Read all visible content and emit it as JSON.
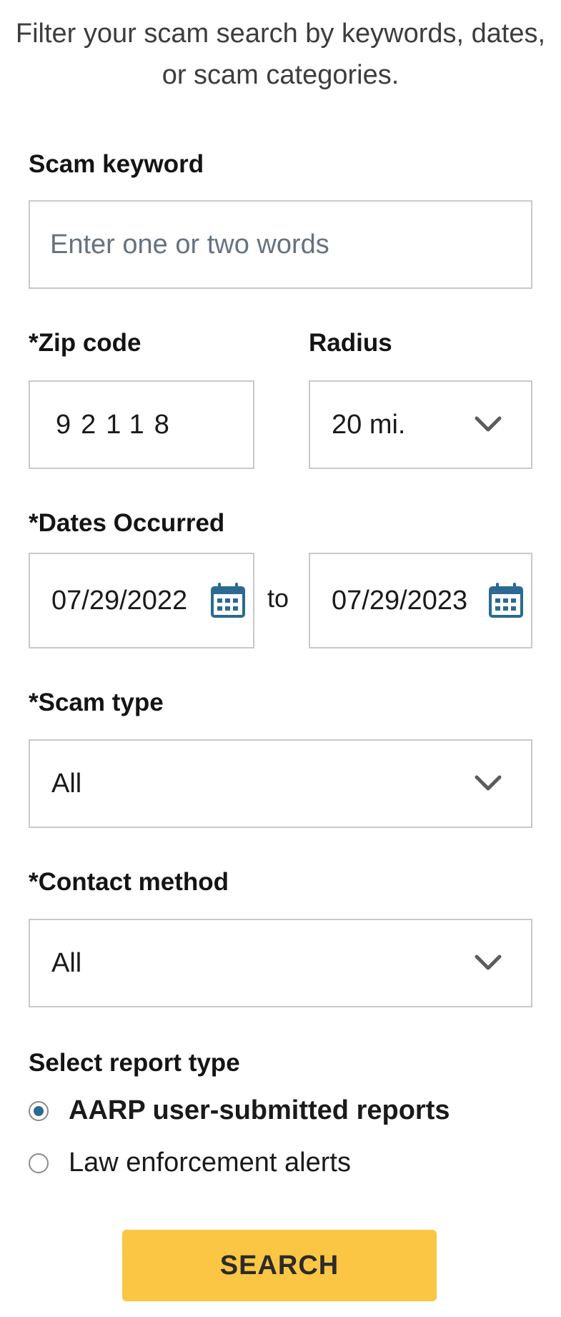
{
  "intro": {
    "line1": "Filter your scam search by keywords, dates,",
    "line2": "or scam categories."
  },
  "keyword": {
    "label": "Scam keyword",
    "placeholder": "Enter one or two words",
    "value": ""
  },
  "zip": {
    "label": "*Zip code",
    "value": "92118"
  },
  "radius": {
    "label": "Radius",
    "selected": "20 mi."
  },
  "dates": {
    "label": "*Dates Occurred",
    "from": "07/29/2022",
    "separator": "to",
    "to": "07/29/2023",
    "icon": "calendar-icon"
  },
  "scam_type": {
    "label": "*Scam type",
    "selected": "All"
  },
  "contact_method": {
    "label": "*Contact method",
    "selected": "All"
  },
  "report_type": {
    "label": "Select report type",
    "options": [
      {
        "label": "AARP user-submitted reports",
        "selected": true
      },
      {
        "label": "Law enforcement alerts",
        "selected": false
      }
    ]
  },
  "search_button": {
    "label": "SEARCH"
  },
  "colors": {
    "accent_button": "#fac643",
    "icon_blue": "#2a6a93",
    "border": "#c9c9c9"
  }
}
